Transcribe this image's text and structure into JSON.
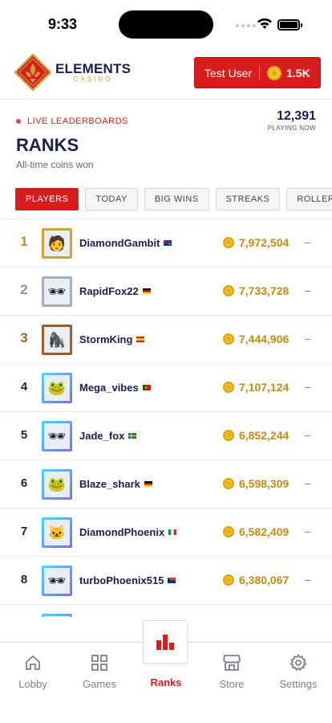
{
  "status_bar": {
    "time": "9:33"
  },
  "header": {
    "logo_title": "ELEMENTS",
    "logo_sub": "CASINO",
    "user_name": "Test User",
    "coins": "1.5K"
  },
  "leaderboard": {
    "live_label": "LIVE LEADERBOARDS",
    "playing_count": "12,391",
    "playing_label": "PLAYING NOW",
    "title": "RANKS",
    "subtitle": "All-time coins won"
  },
  "tabs": [
    {
      "label": "PLAYERS",
      "active": true
    },
    {
      "label": "TODAY",
      "active": false
    },
    {
      "label": "BIG WINS",
      "active": false
    },
    {
      "label": "STREAKS",
      "active": false
    },
    {
      "label": "ROLLERS",
      "active": false
    }
  ],
  "rows": [
    {
      "rank": "1",
      "name": "DiamondGambit",
      "score": "7,972,504",
      "change": "–",
      "flag": "AU",
      "frame": "gold",
      "avatar": "🧑"
    },
    {
      "rank": "2",
      "name": "RapidFox22",
      "score": "7,733,728",
      "change": "–",
      "flag": "DE",
      "frame": "silver",
      "avatar": "🕶"
    },
    {
      "rank": "3",
      "name": "StormKing",
      "score": "7,444,906",
      "change": "–",
      "flag": "ES",
      "frame": "bronze",
      "avatar": "🦍"
    },
    {
      "rank": "4",
      "name": "Mega_vibes",
      "score": "7,107,124",
      "change": "–",
      "flag": "PT",
      "frame": "cyan",
      "avatar": "🐸"
    },
    {
      "rank": "5",
      "name": "Jade_fox",
      "score": "6,852,244",
      "change": "–",
      "flag": "SE",
      "frame": "cyan",
      "avatar": "🕶"
    },
    {
      "rank": "6",
      "name": "Blaze_shark",
      "score": "6,598,309",
      "change": "–",
      "flag": "DE",
      "frame": "cyan",
      "avatar": "🐸"
    },
    {
      "rank": "7",
      "name": "DiamondPhoenix",
      "score": "6,582,409",
      "change": "–",
      "flag": "IT",
      "frame": "cyan",
      "avatar": "🐱"
    },
    {
      "rank": "8",
      "name": "turboPhoenix515",
      "score": "6,380,067",
      "change": "–",
      "flag": "ZA",
      "frame": "cyan",
      "avatar": "🕶"
    }
  ],
  "nav": [
    {
      "label": "Lobby",
      "icon": "home-icon"
    },
    {
      "label": "Games",
      "icon": "grid-icon"
    },
    {
      "label": "Ranks",
      "icon": "bar-chart-icon",
      "active": true
    },
    {
      "label": "Store",
      "icon": "store-icon"
    },
    {
      "label": "Settings",
      "icon": "gear-icon"
    }
  ],
  "colors": {
    "accent": "#d71d1d",
    "gold": "#c48a12",
    "navy": "#1b1f4b"
  }
}
